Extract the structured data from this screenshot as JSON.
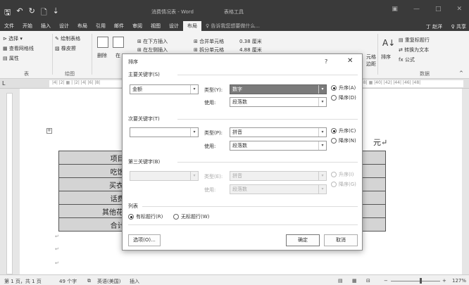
{
  "titlebar": {
    "save": "🖫",
    "undo": "↶",
    "redo": "↻",
    "newdoc": "🗋",
    "qat_more": "⇣",
    "doc_title": "消费情况表 - Word",
    "context_tools": "表格工具",
    "win_icon": "▣",
    "minimize": "—",
    "maximize": "□",
    "close": "✕"
  },
  "menu": {
    "items": [
      "文件",
      "开始",
      "插入",
      "设计",
      "布局",
      "引用",
      "邮件",
      "审阅",
      "视图",
      "设计",
      "布局"
    ],
    "tell_me": "♀ 告诉我您想要做什么...",
    "user": "丁 赵洋",
    "share": "♀ 共享"
  },
  "ribbon": {
    "select": "⊳ 选择 ▾",
    "gridlines": "▦ 查看网格线",
    "properties": "▤ 属性",
    "group_table": "表",
    "draw_table": "✎ 绘制表格",
    "eraser": "▨ 橡皮擦",
    "group_draw": "绘图",
    "delete": "删除",
    "insert_above": "在",
    "insert_below": "⊞ 在下方插入",
    "insert_left": "⊞ 在左侧插入",
    "merge": "⊞ 合并单元格",
    "split": "⊞ 拆分单元格",
    "height": "0.38 厘米",
    "width": "4.88 厘米",
    "align_group": "元格",
    "align_group2": "边距",
    "sort": "排序",
    "repeat_header": "▤ 重复标题行",
    "to_text": "⇄ 转换为文本",
    "formula": "fx 公式",
    "group_data": "数据",
    "collapse": "^"
  },
  "ruler": {
    "text": "|4|  |2|  ▦  |  |2|  |4|  |6|  |8|",
    "text_right": "|38| ▦ |40|  |42|  |44|  |46|  |48|"
  },
  "document": {
    "yuan": "元↵",
    "handle": "✛",
    "rows": [
      {
        "label": "项目↵",
        "value": "↵"
      },
      {
        "label": "吃饭↵",
        "value": "↵"
      },
      {
        "label": "买衣服",
        "value": "↵"
      },
      {
        "label": "话费↵",
        "value": "↵"
      },
      {
        "label": "其他花费",
        "value": "↵"
      },
      {
        "label": "合计↵",
        "value": "↵"
      }
    ],
    "para_marks": [
      "↵",
      "↵",
      "↵"
    ]
  },
  "dialog": {
    "title": "排序",
    "help": "?",
    "close": "✕",
    "primary": {
      "label": "主要关键字(S)",
      "key": "金额",
      "type_label": "类型(Y):",
      "type_value": "数字",
      "using_label": "使用:",
      "using_value": "段落数",
      "asc": "升序(A)",
      "desc": "降序(D)"
    },
    "secondary": {
      "label": "次要关键字(T)",
      "key": "",
      "type_label": "类型(P):",
      "type_value": "拼音",
      "using_label": "使用:",
      "using_value": "段落数",
      "asc": "升序(C)",
      "desc": "降序(N)"
    },
    "third": {
      "label": "第三关键字(B)",
      "key": "",
      "type_label": "类型(E):",
      "type_value": "拼音",
      "using_label": "使用:",
      "using_value": "段落数",
      "asc": "升序(I)",
      "desc": "降序(G)"
    },
    "list": {
      "label": "列表",
      "header": "有标题行(R)",
      "noheader": "无标题行(W)"
    },
    "options": "选项(O)...",
    "ok": "确定",
    "cancel": "取消"
  },
  "statusbar": {
    "page": "第 1 页，共 1 页",
    "words": "49 个字",
    "proof": "⧉",
    "lang": "英语(美国)",
    "mode": "插入",
    "zoom": "127%"
  }
}
